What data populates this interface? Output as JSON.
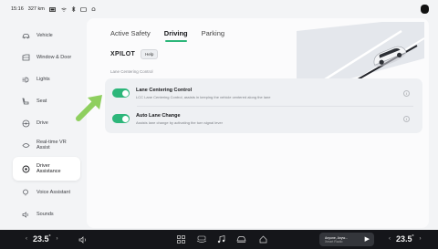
{
  "status": {
    "time": "15:16",
    "range": "327 km",
    "icons": [
      "battery-icon",
      "wifi-icon",
      "bluetooth-icon",
      "cellular-icon",
      "notification-icon"
    ]
  },
  "sidebar": {
    "items": [
      {
        "label": "Vehicle",
        "icon": "car-icon"
      },
      {
        "label": "Window & Door",
        "icon": "window-icon"
      },
      {
        "label": "Lights",
        "icon": "lights-icon"
      },
      {
        "label": "Seat",
        "icon": "seat-icon"
      },
      {
        "label": "Drive",
        "icon": "steering-icon"
      },
      {
        "label": "Real-time VR\nAssist",
        "icon": "vr-icon"
      },
      {
        "label": "Driver\nAssistance",
        "icon": "assist-icon",
        "active": true
      },
      {
        "label": "Voice Assistant",
        "icon": "voice-icon"
      },
      {
        "label": "Sounds",
        "icon": "speaker-icon"
      }
    ]
  },
  "tabs": [
    "Active Safety",
    "Driving",
    "Parking"
  ],
  "active_tab": "Driving",
  "xpilot": {
    "title": "XPILOT",
    "help": "Help"
  },
  "section_label": "Lane Centering Control",
  "settings": [
    {
      "name": "Lane Centering Control",
      "desc": "LCC Lane Centering Control, assists in keeping the vehicle centered along the lane",
      "enabled": true
    },
    {
      "name": "Auto Lane Change",
      "desc": "Assists lane change by activating the turn signal lever",
      "enabled": true
    }
  ],
  "info_glyph": "i",
  "bottom": {
    "left_temp": "23.5",
    "right_temp": "23.5",
    "unit": "°",
    "media_title": "Anyone, Anyw...",
    "media_sub": "Xmart Radio"
  },
  "colors": {
    "accent": "#2db67a",
    "dock": "#15161a"
  }
}
